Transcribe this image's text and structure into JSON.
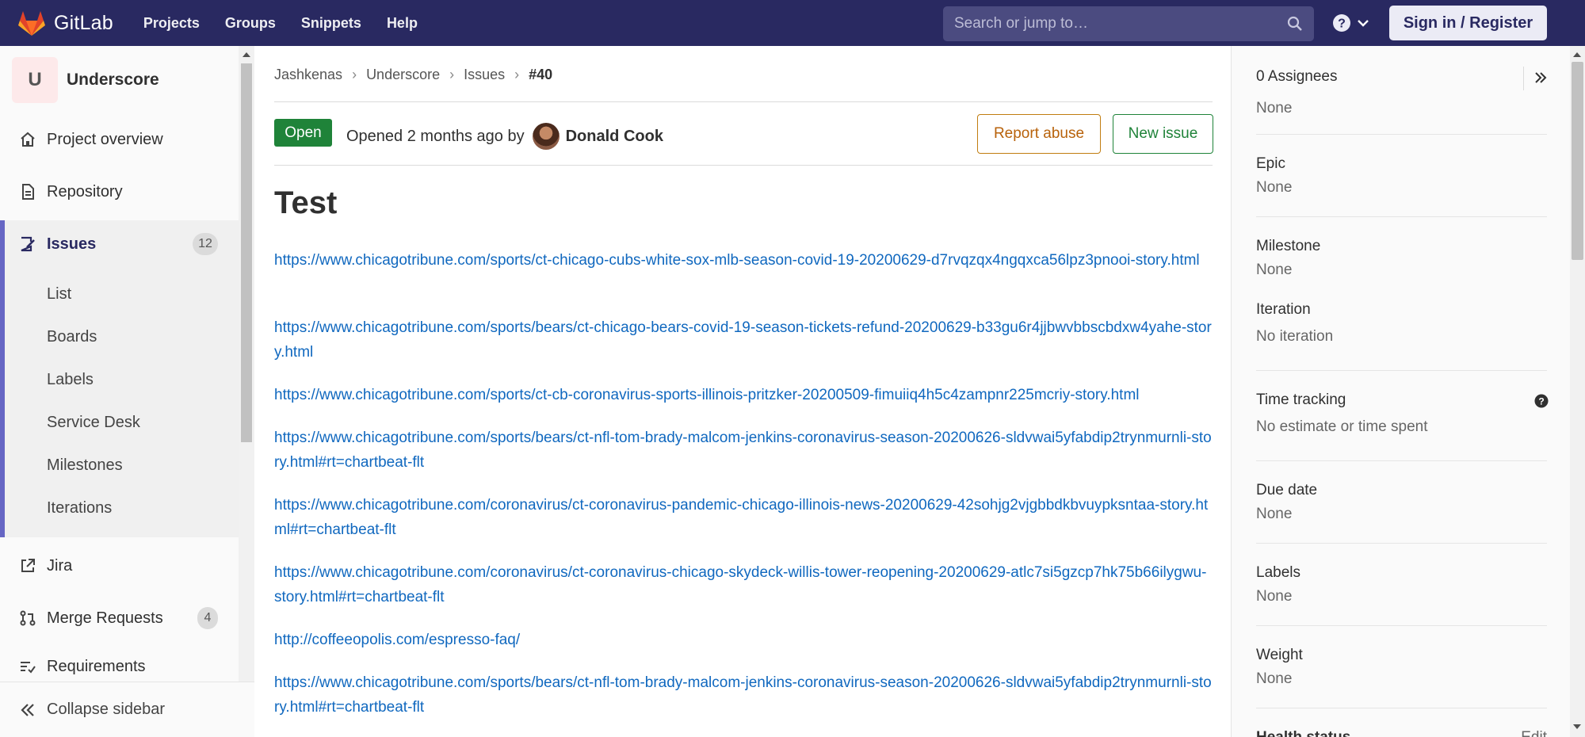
{
  "navbar": {
    "brand": "GitLab",
    "links": [
      "Projects",
      "Groups",
      "Snippets",
      "Help"
    ],
    "search_placeholder": "Search or jump to…",
    "signin_label": "Sign in / Register"
  },
  "sidebar": {
    "project_initial": "U",
    "project_name": "Underscore",
    "items": {
      "overview": "Project overview",
      "repository": "Repository",
      "issues": "Issues",
      "issues_count": "12",
      "jira": "Jira",
      "merge_requests": "Merge Requests",
      "mr_count": "4",
      "requirements": "Requirements"
    },
    "issue_subitems": [
      "List",
      "Boards",
      "Labels",
      "Service Desk",
      "Milestones",
      "Iterations"
    ],
    "collapse_label": "Collapse sidebar"
  },
  "breadcrumb": {
    "items": [
      "Jashkenas",
      "Underscore",
      "Issues"
    ],
    "current": "#40"
  },
  "issue": {
    "status": "Open",
    "opened_text": "Opened 2 months ago by",
    "author": "Donald Cook",
    "report_abuse": "Report abuse",
    "new_issue": "New issue",
    "title": "Test",
    "links": [
      "https://www.chicagotribune.com/sports/ct-chicago-cubs-white-sox-mlb-season-covid-19-20200629-d7rvqzqx4ngqxca56lpz3pnooi-story.html",
      "https://www.chicagotribune.com/sports/bears/ct-chicago-bears-covid-19-season-tickets-refund-20200629-b33gu6r4jjbwvbbscbdxw4yahe-story.html",
      "https://www.chicagotribune.com/sports/ct-cb-coronavirus-sports-illinois-pritzker-20200509-fimuiiq4h5c4zampnr225mcriy-story.html",
      "https://www.chicagotribune.com/sports/bears/ct-nfl-tom-brady-malcom-jenkins-coronavirus-season-20200626-sldvwai5yfabdip2trynmurnli-story.html#rt=chartbeat-flt",
      "https://www.chicagotribune.com/coronavirus/ct-coronavirus-pandemic-chicago-illinois-news-20200629-42sohjg2vjgbbdkbvuypksntaa-story.html#rt=chartbeat-flt",
      "https://www.chicagotribune.com/coronavirus/ct-coronavirus-chicago-skydeck-willis-tower-reopening-20200629-atlc7si5gzcp7hk75b66ilygwu-story.html#rt=chartbeat-flt",
      "http://coffeeopolis.com/espresso-faq/",
      "https://www.chicagotribune.com/sports/bears/ct-nfl-tom-brady-malcom-jenkins-coronavirus-season-20200626-sldvwai5yfabdip2trynmurnli-story.html#rt=chartbeat-flt"
    ]
  },
  "right_sidebar": {
    "assignees_label": "0 Assignees",
    "assignees_value": "None",
    "epic_label": "Epic",
    "epic_value": "None",
    "milestone_label": "Milestone",
    "milestone_value": "None",
    "iteration_label": "Iteration",
    "iteration_value": "No iteration",
    "time_label": "Time tracking",
    "time_value": "No estimate or time spent",
    "due_label": "Due date",
    "due_value": "None",
    "labels_label": "Labels",
    "labels_value": "None",
    "weight_label": "Weight",
    "weight_value": "None",
    "health_label": "Health status",
    "health_edit": "Edit"
  },
  "colors": {
    "navbar": "#292961",
    "link": "#1068bf",
    "open_badge": "#1f8339",
    "abuse": "#b8620b"
  }
}
